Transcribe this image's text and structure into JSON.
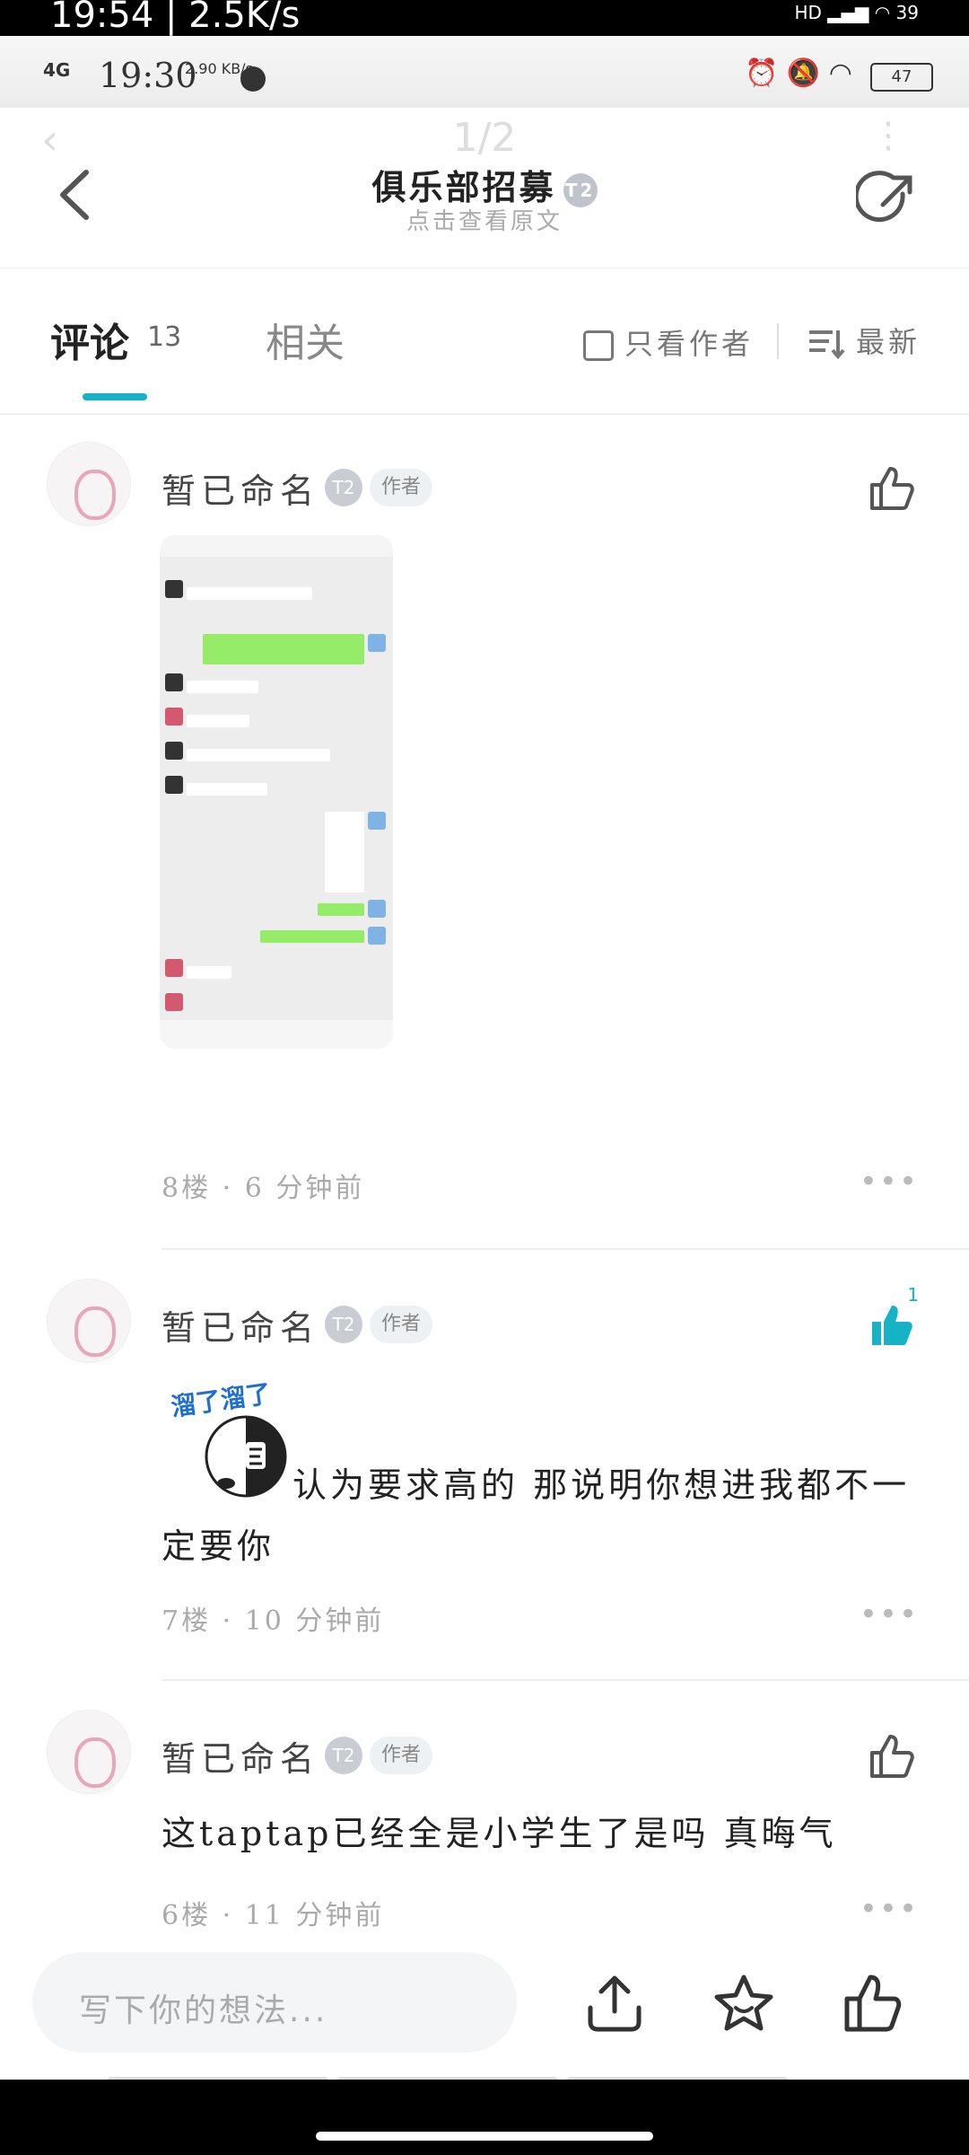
{
  "overlay_status": {
    "time": "19:54 | 2.5K/s",
    "battery": "39"
  },
  "status_bar": {
    "network": "4G",
    "clock": "19:30",
    "speed": "2.90 KB/s",
    "battery": "47"
  },
  "header": {
    "pager": "1/2",
    "title": "俱乐部招募",
    "level_badge": "T2",
    "subtitle": "点击查看原文"
  },
  "tabs": {
    "comments_label": "评论",
    "comments_count": "13",
    "related_label": "相关",
    "author_only_label": "只看作者",
    "sort_label": "最新"
  },
  "comments": [
    {
      "user": "暂已命名",
      "level": "T2",
      "tag": "作者",
      "meta": "8楼 · 6 分钟前",
      "liked": false,
      "likes": ""
    },
    {
      "user": "暂已命名",
      "level": "T2",
      "tag": "作者",
      "sticker_text": "溜了溜了",
      "text": "认为要求高的 那说明你想进我都不一定要你",
      "meta": "7楼 · 10 分钟前",
      "liked": true,
      "likes": "1"
    },
    {
      "user": "暂已命名",
      "level": "T2",
      "tag": "作者",
      "text": "这taptap已经全是小学生了是吗 真晦气",
      "meta": "6楼 · 11 分钟前",
      "liked": false,
      "likes": ""
    }
  ],
  "bottom_bar": {
    "placeholder": "写下你的想法..."
  },
  "colors": {
    "accent": "#16b3c6",
    "text": "#222222",
    "muted": "#aaaaaa"
  },
  "icons": [
    "back-icon",
    "share-icon",
    "checkbox-icon",
    "sort-icon",
    "like-icon",
    "more-icon",
    "upload-icon",
    "star-icon"
  ]
}
